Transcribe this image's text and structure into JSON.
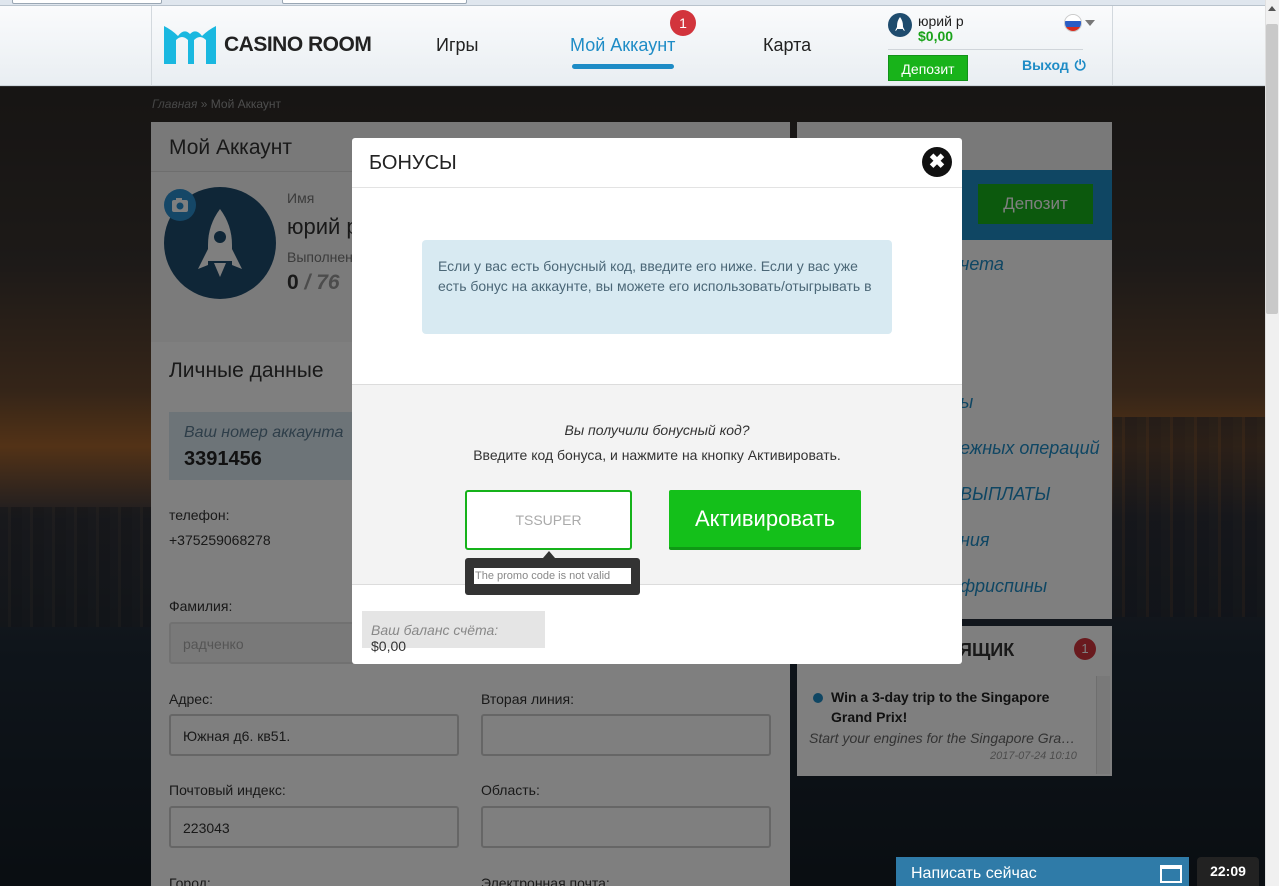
{
  "header": {
    "logo_text": "CASINO ROOM",
    "nav": [
      {
        "label": "Игры"
      },
      {
        "label": "Мой Аккаунт",
        "badge": "1"
      },
      {
        "label": "Карта"
      }
    ],
    "user": {
      "name": "юрий р",
      "balance": "$0,00",
      "deposit_label": "Депозит",
      "logout_label": "Выход"
    }
  },
  "breadcrumb": {
    "home": "Главная",
    "sep": "»",
    "current": "Мой Аккаунт"
  },
  "account": {
    "title": "Мой Аккаунт",
    "name_label": "Имя",
    "name_value": "юрий р",
    "completed_label": "Выполнен",
    "progress_current": "0",
    "progress_total": "/ 76",
    "personal_title": "Личные данные",
    "account_number_label": "Ваш номер аккаунта",
    "account_number": "3391456",
    "phone_label": "телефон:",
    "phone_value": "+375259068278",
    "surname_label": "Фамилия:",
    "surname_value": "радченко",
    "address_label": "Адрес:",
    "address_value": "Южная д6. кв51.",
    "address2_label": "Вторая линия:",
    "postcode_label": "Почтовый индекс:",
    "postcode_value": "223043",
    "region_label": "Область:",
    "city_label": "Город:",
    "email_label": "Электронная почта:"
  },
  "sidebar": {
    "deposit_label": "Депозит",
    "links": [
      "чета",
      "ы",
      "ежных операций",
      "ВЫПЛАТЫ",
      "ния",
      "фриспины"
    ],
    "inbox_title": "ЯЩИК",
    "inbox_badge": "1",
    "message": {
      "subject": "Win a 3-day trip to the Singapore Grand Prix!",
      "preview": "Start your engines for the Singapore Gran…",
      "date": "2017-07-24 10:10"
    }
  },
  "modal": {
    "title": "БОНУСЫ",
    "close_symbol": "✖",
    "info_text": "Если у вас есть бонусный код, введите его ниже. Если у вас уже есть бонус на аккаунте, вы можете его использовать/отыгрывать в",
    "promo_question": "Вы получили бонусный код?",
    "promo_instruction": "Введите код бонуса, и нажмите на кнопку Активировать.",
    "promo_value": "TSSUPER",
    "activate_label": "Активировать",
    "error_tooltip": "The promo code is not valid",
    "balance_label": "Ваш баланс счёта:",
    "balance_value": "$0,00"
  },
  "chat": {
    "label": "Написать сейчас"
  },
  "clock": "22:09",
  "colors": {
    "accent": "#1e8cc6",
    "success": "#14c01a",
    "badge": "#d2343c"
  }
}
